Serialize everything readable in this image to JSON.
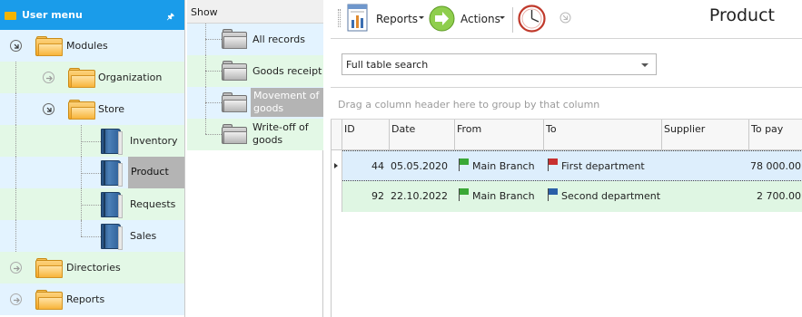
{
  "menu": {
    "title": "User menu",
    "items": [
      {
        "label": "Modules"
      },
      {
        "label": "Organization"
      },
      {
        "label": "Store"
      },
      {
        "label": "Inventory"
      },
      {
        "label": "Product"
      },
      {
        "label": "Requests"
      },
      {
        "label": "Sales"
      },
      {
        "label": "Directories"
      },
      {
        "label": "Reports"
      }
    ]
  },
  "show": {
    "header": "Show",
    "items": [
      {
        "label": "All records"
      },
      {
        "label": "Goods receipt"
      },
      {
        "label": "Movement of goods",
        "line1": "Movement of",
        "line2": "goods"
      },
      {
        "label": "Write-off of goods",
        "line1": "Write-off of",
        "line2": "goods"
      }
    ]
  },
  "toolbar": {
    "reports_label": "Reports",
    "actions_label": "Actions"
  },
  "page_title": "Product",
  "search": {
    "value": "Full table search"
  },
  "group_panel_text": "Drag a column header here to group by that column",
  "grid": {
    "columns": [
      "ID",
      "Date",
      "From",
      "To",
      "Supplier",
      "To pay"
    ],
    "rows": [
      {
        "id": "44",
        "date": "05.05.2020",
        "from": "Main Branch",
        "to": "First department",
        "supplier": "",
        "to_pay": "78 000.00"
      },
      {
        "id": "92",
        "date": "22.10.2022",
        "from": "Main Branch",
        "to": "Second department",
        "supplier": "",
        "to_pay": "2 700.00"
      }
    ]
  },
  "colors": {
    "menu_header": "#1a9cea",
    "row_blue": "#e3f3ff",
    "row_green": "#e3f8e6",
    "selection_gray": "#b4b4b4",
    "flag_green": "#3aa836",
    "flag_red": "#c83030",
    "flag_blue": "#2a5fa8"
  }
}
